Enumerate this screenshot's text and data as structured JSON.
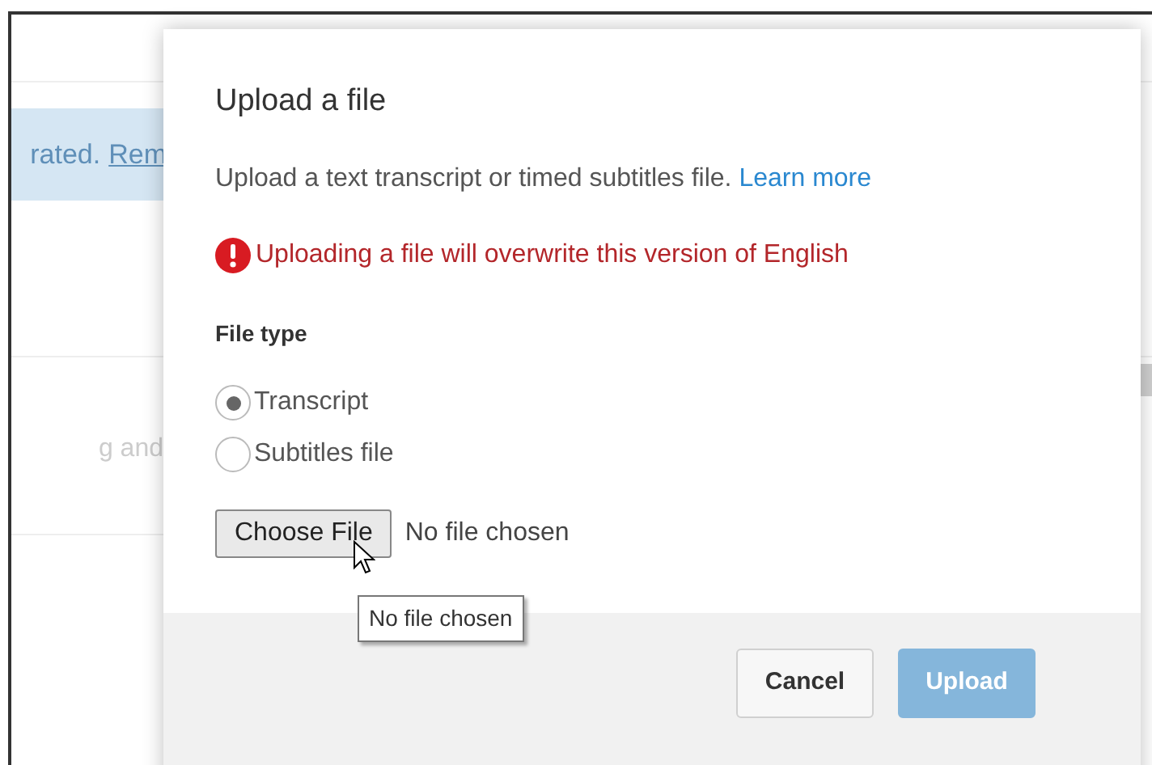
{
  "background": {
    "banner": {
      "text": "rated.",
      "link": "Rem"
    },
    "row_text": "g and"
  },
  "dialog": {
    "title": "Upload a file",
    "description": "Upload a text transcript or timed subtitles file.",
    "learn_more": "Learn more",
    "warning": "Uploading a file will overwrite this version of English",
    "file_type_label": "File type",
    "options": [
      {
        "label": "Transcript",
        "selected": true
      },
      {
        "label": "Subtitles file",
        "selected": false
      }
    ],
    "choose_file": "Choose File",
    "file_status": "No file chosen",
    "tooltip": "No file chosen",
    "buttons": [
      {
        "label": "Cancel",
        "kind": "secondary",
        "disabled": false
      },
      {
        "label": "Upload",
        "kind": "primary",
        "disabled": true
      }
    ]
  }
}
